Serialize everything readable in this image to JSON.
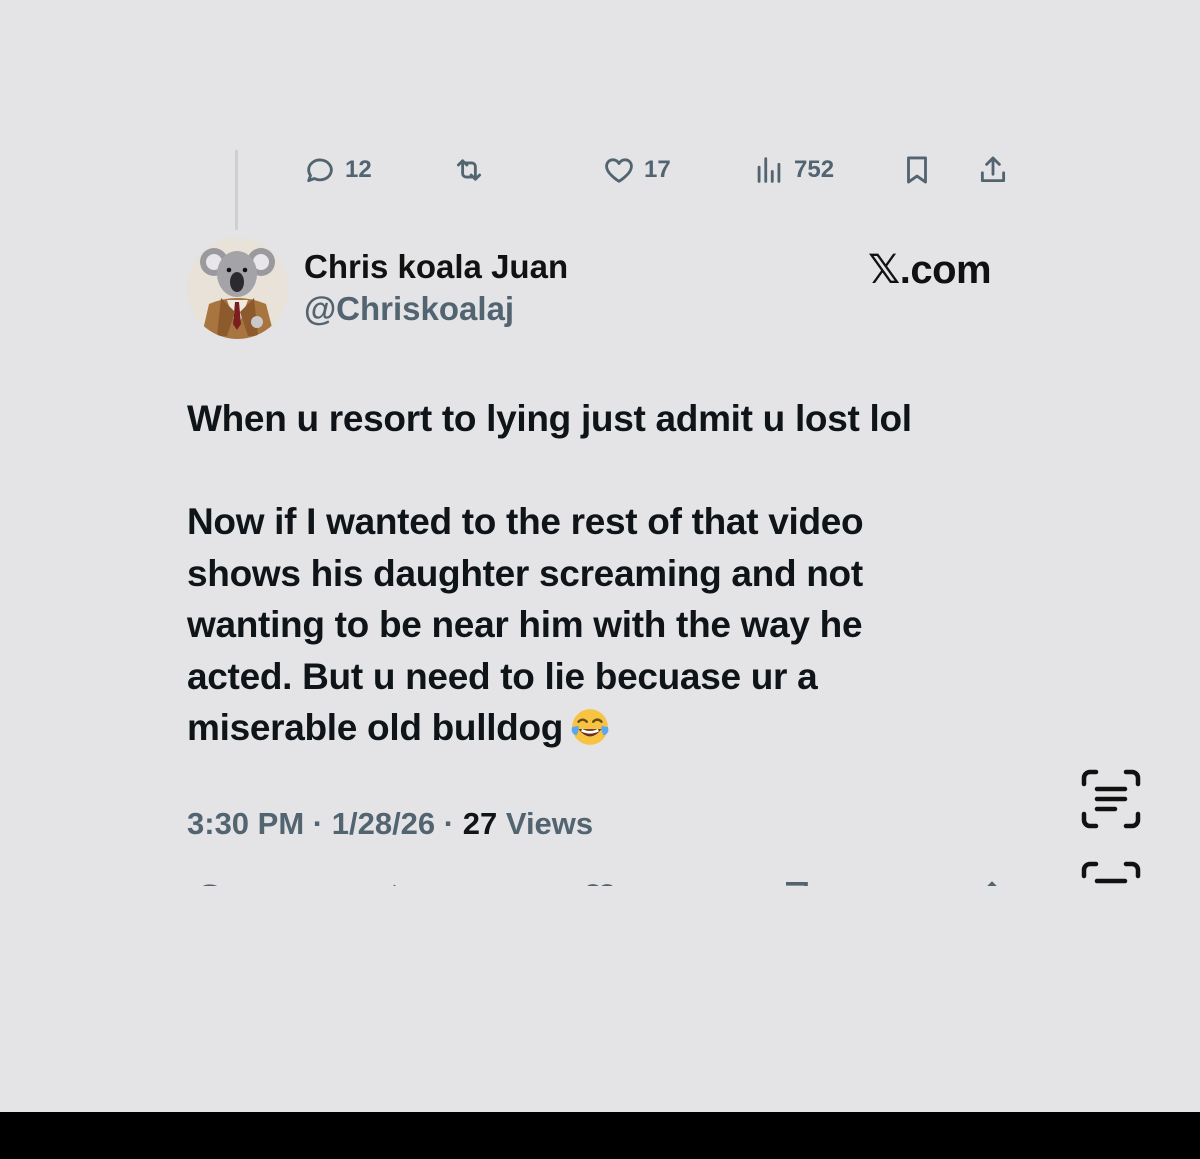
{
  "previous_tweet_actions": {
    "replies": "12",
    "retweets": "",
    "likes": "17",
    "views": "752"
  },
  "author": {
    "display_name": "Chris koala Juan",
    "handle": "@Chriskoalaj"
  },
  "brand": {
    "x_glyph": "𝕏",
    "domain": ".com"
  },
  "tweet": {
    "paragraph_1": "When u resort to lying just admit u lost lol",
    "paragraph_2": "Now if I wanted to the rest of that video shows his daughter screaming and not wanting to be near him with the way he acted. But u need to lie becuase ur a miserable old bulldog",
    "emoji": "tears-of-joy-emoji"
  },
  "meta": {
    "time": "3:30 PM",
    "separator_1": " · ",
    "date": "1/28/26",
    "separator_2": " · ",
    "views_count": "27",
    "views_label": " Views"
  },
  "icons": {
    "reply": "reply-icon",
    "retweet": "retweet-icon",
    "like": "heart-icon",
    "views": "views-icon",
    "bookmark": "bookmark-icon",
    "share": "share-icon",
    "live_text": "live-text-icon"
  },
  "colors": {
    "background": "#e4e4e6",
    "text_primary": "#0f1419",
    "text_secondary": "#536471"
  }
}
